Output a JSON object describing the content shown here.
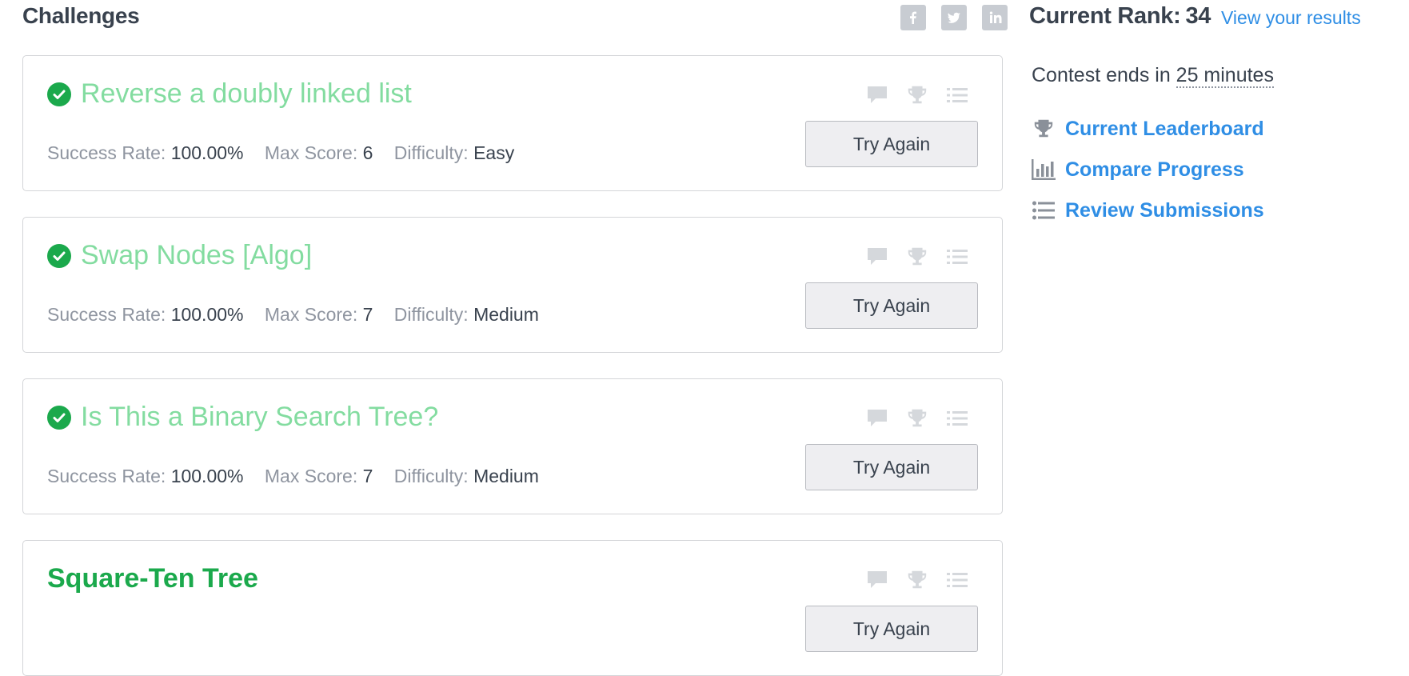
{
  "header": {
    "title": "Challenges",
    "rank_label": "Current Rank:",
    "rank_value": "34",
    "view_results": "View your results",
    "social": [
      "facebook-icon",
      "twitter-icon",
      "linkedin-icon"
    ]
  },
  "challenges": [
    {
      "title": "Reverse a doubly linked list",
      "solved": true,
      "success_rate_label": "Success Rate:",
      "success_rate": "100.00%",
      "max_score_label": "Max Score:",
      "max_score": "6",
      "difficulty_label": "Difficulty:",
      "difficulty": "Easy",
      "button": "Try Again"
    },
    {
      "title": "Swap Nodes [Algo]",
      "solved": true,
      "success_rate_label": "Success Rate:",
      "success_rate": "100.00%",
      "max_score_label": "Max Score:",
      "max_score": "7",
      "difficulty_label": "Difficulty:",
      "difficulty": "Medium",
      "button": "Try Again"
    },
    {
      "title": "Is This a Binary Search Tree?",
      "solved": true,
      "success_rate_label": "Success Rate:",
      "success_rate": "100.00%",
      "max_score_label": "Max Score:",
      "max_score": "7",
      "difficulty_label": "Difficulty:",
      "difficulty": "Medium",
      "button": "Try Again"
    },
    {
      "title": "Square-Ten Tree",
      "solved": false,
      "button": "Try Again"
    }
  ],
  "sidebar": {
    "contest_prefix": "Contest ends in",
    "contest_time": "25 minutes",
    "links": [
      {
        "label": "Current Leaderboard",
        "icon": "trophy-icon"
      },
      {
        "label": "Compare Progress",
        "icon": "bar-chart-icon"
      },
      {
        "label": "Review Submissions",
        "icon": "list-icon"
      }
    ]
  },
  "colors": {
    "accent_green": "#1ba94c",
    "solved_title": "#83dca0",
    "link_blue": "#2f8ee5"
  }
}
